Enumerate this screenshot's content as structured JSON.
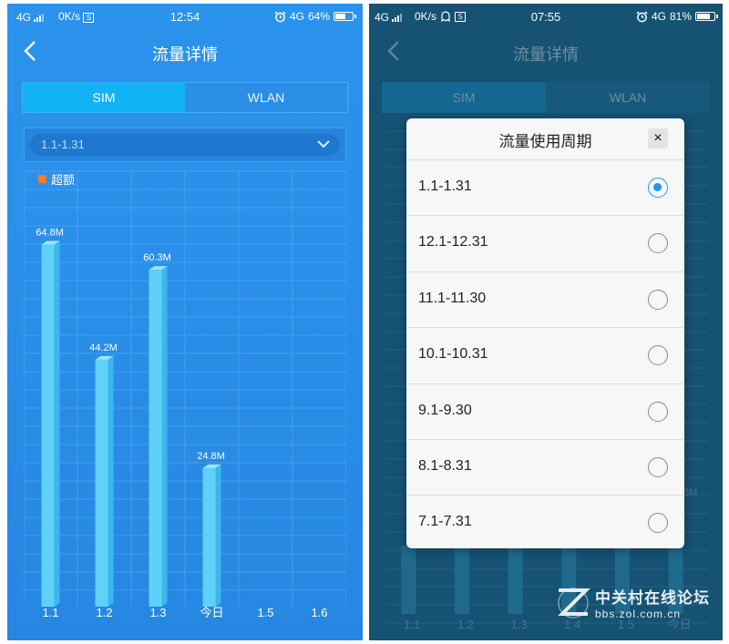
{
  "left_phone": {
    "status": {
      "network": "4G",
      "speed": "0K/s",
      "sim_icon": "S",
      "time": "12:54",
      "alarm_icon": "alarm-icon",
      "net_type": "4G",
      "battery": "64%",
      "battery_level": 0.64
    },
    "title": "流量详情",
    "tabs": [
      {
        "label": "SIM",
        "active": true
      },
      {
        "label": "WLAN",
        "active": false
      }
    ],
    "period": "1.1-1.31",
    "legend_label": "超额",
    "colors": {
      "bg": "#2a8fea",
      "bar": "#5fd0f8",
      "over": "#f47b28"
    }
  },
  "chart_data": {
    "type": "bar",
    "categories": [
      "1.1",
      "1.2",
      "1.3",
      "今日",
      "1.5",
      "1.6"
    ],
    "values": [
      64.8,
      44.2,
      60.3,
      24.8,
      null,
      null
    ],
    "data_labels": [
      "64.8M",
      "44.2M",
      "60.3M",
      "24.8M",
      "",
      ""
    ],
    "ylim": [
      0,
      75
    ],
    "grid": true
  },
  "right_phone": {
    "status": {
      "network": "4G",
      "speed": "0K/s",
      "sim_icon": "S",
      "time": "07:55",
      "alarm_icon": "alarm-icon",
      "net_type": "4G",
      "battery": "81%",
      "battery_level": 0.81
    },
    "title": "流量详情",
    "tabs": [
      {
        "label": "SIM"
      },
      {
        "label": "WLAN"
      }
    ],
    "dialog": {
      "title": "流量使用周期",
      "close_label": "×",
      "options": [
        {
          "label": "1.1-1.31",
          "selected": true
        },
        {
          "label": "12.1-12.31",
          "selected": false
        },
        {
          "label": "11.1-11.30",
          "selected": false
        },
        {
          "label": "10.1-10.31",
          "selected": false
        },
        {
          "label": "9.1-9.30",
          "selected": false
        },
        {
          "label": "8.1-8.31",
          "selected": false
        },
        {
          "label": "7.1-7.31",
          "selected": false
        }
      ]
    },
    "background_axis_labels": [
      "1.1",
      "1.2",
      "1.3",
      "1.4",
      "1.5",
      "今日"
    ],
    "background_value_fragment": "3M"
  },
  "watermark": {
    "name": "中关村在线论坛",
    "url": "bbs.zol.com.cn"
  }
}
